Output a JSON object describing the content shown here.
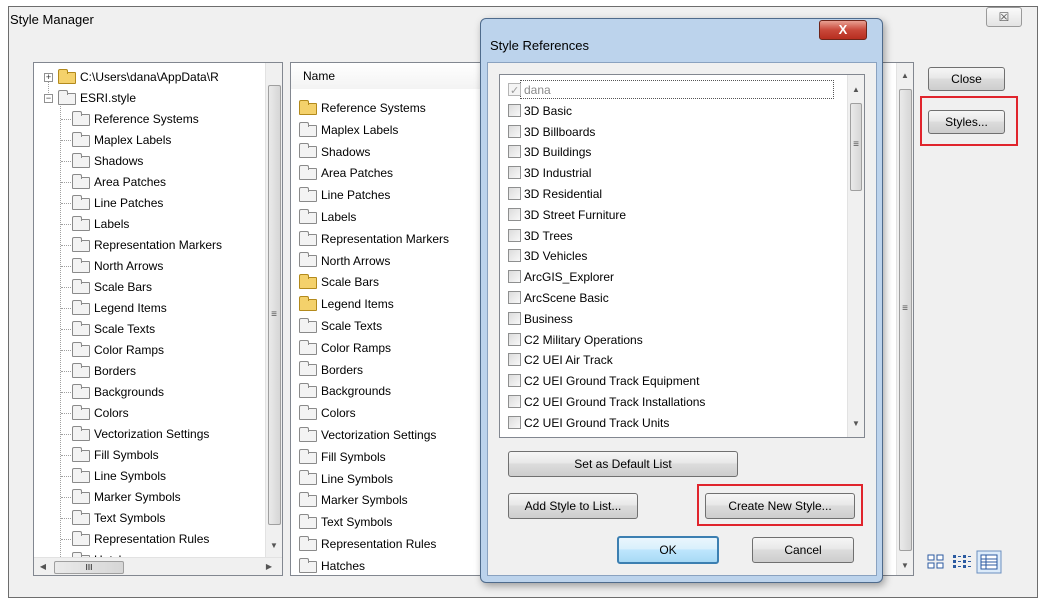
{
  "style_manager": {
    "title": "Style Manager",
    "close_x_glyph": "☒",
    "tree": {
      "root_path": "C:\\Users\\dana\\AppData\\R",
      "style_file": "ESRI.style",
      "children": [
        "Reference Systems",
        "Maplex Labels",
        "Shadows",
        "Area Patches",
        "Line Patches",
        "Labels",
        "Representation Markers",
        "North Arrows",
        "Scale Bars",
        "Legend Items",
        "Scale Texts",
        "Color Ramps",
        "Borders",
        "Backgrounds",
        "Colors",
        "Vectorization Settings",
        "Fill Symbols",
        "Line Symbols",
        "Marker Symbols",
        "Text Symbols",
        "Representation Rules",
        "Hatches"
      ],
      "hscroll_thumb_glyph": "III"
    },
    "contents": {
      "column_header": "Name",
      "items": [
        {
          "label": "Reference Systems",
          "has_items": true
        },
        {
          "label": "Maplex Labels",
          "has_items": false
        },
        {
          "label": "Shadows",
          "has_items": false
        },
        {
          "label": "Area Patches",
          "has_items": false
        },
        {
          "label": "Line Patches",
          "has_items": false
        },
        {
          "label": "Labels",
          "has_items": false
        },
        {
          "label": "Representation Markers",
          "has_items": false
        },
        {
          "label": "North Arrows",
          "has_items": false
        },
        {
          "label": "Scale Bars",
          "has_items": true
        },
        {
          "label": "Legend Items",
          "has_items": true
        },
        {
          "label": "Scale Texts",
          "has_items": false
        },
        {
          "label": "Color Ramps",
          "has_items": false
        },
        {
          "label": "Borders",
          "has_items": false
        },
        {
          "label": "Backgrounds",
          "has_items": false
        },
        {
          "label": "Colors",
          "has_items": false
        },
        {
          "label": "Vectorization Settings",
          "has_items": false
        },
        {
          "label": "Fill Symbols",
          "has_items": false
        },
        {
          "label": "Line Symbols",
          "has_items": false
        },
        {
          "label": "Marker Symbols",
          "has_items": false
        },
        {
          "label": "Text Symbols",
          "has_items": false
        },
        {
          "label": "Representation Rules",
          "has_items": false
        },
        {
          "label": "Hatches",
          "has_items": false
        }
      ]
    },
    "buttons": {
      "close": "Close",
      "styles": "Styles..."
    },
    "view_icons": [
      "large-icons-view-icon",
      "list-view-icon",
      "details-view-icon"
    ]
  },
  "style_references": {
    "title": "Style References",
    "close_glyph": "X",
    "styles": [
      {
        "label": "dana",
        "checked": true,
        "disabled": true
      },
      {
        "label": "3D Basic",
        "checked": false
      },
      {
        "label": "3D Billboards",
        "checked": false
      },
      {
        "label": "3D Buildings",
        "checked": false
      },
      {
        "label": "3D Industrial",
        "checked": false
      },
      {
        "label": "3D Residential",
        "checked": false
      },
      {
        "label": "3D Street Furniture",
        "checked": false
      },
      {
        "label": "3D Trees",
        "checked": false
      },
      {
        "label": "3D Vehicles",
        "checked": false
      },
      {
        "label": "ArcGIS_Explorer",
        "checked": false
      },
      {
        "label": "ArcScene Basic",
        "checked": false
      },
      {
        "label": "Business",
        "checked": false
      },
      {
        "label": "C2 Military Operations",
        "checked": false
      },
      {
        "label": "C2 UEI Air Track",
        "checked": false
      },
      {
        "label": "C2 UEI Ground Track Equipment",
        "checked": false
      },
      {
        "label": "C2 UEI Ground Track Installations",
        "checked": false
      },
      {
        "label": "C2 UEI Ground Track Units",
        "checked": false
      }
    ],
    "buttons": {
      "set_default": "Set as Default List",
      "add_style": "Add Style to List...",
      "create_new": "Create New Style...",
      "ok": "OK",
      "cancel": "Cancel"
    }
  },
  "colors": {
    "highlight": "#e0242c",
    "dialog_frame": "#bcd3ec",
    "folder_yellow": "#f4d16b"
  }
}
